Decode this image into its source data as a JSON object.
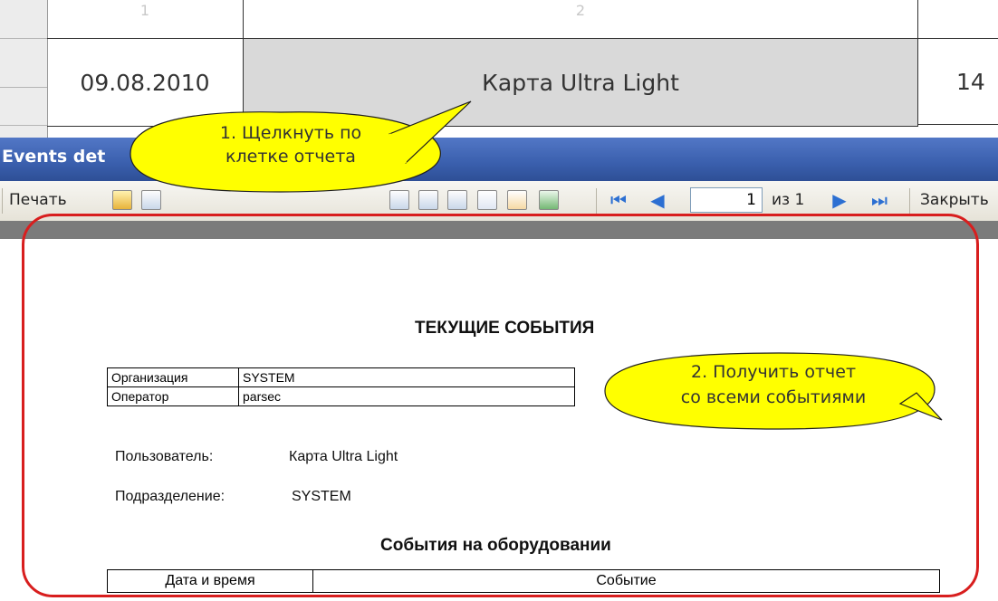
{
  "grid": {
    "header_cols": [
      "1",
      "2"
    ],
    "row": {
      "date": "09.08.2010",
      "card": "Карта Ultra Light",
      "number": "14"
    }
  },
  "window": {
    "title": "Events det"
  },
  "toolbar": {
    "print_label": "Печать",
    "page_value": "1",
    "page_of": "из 1",
    "close_label": "Закрыть"
  },
  "report": {
    "title": "ТЕКУЩИЕ СОБЫТИЯ",
    "info": [
      {
        "key": "Организация",
        "value": "SYSTEM"
      },
      {
        "key": "Оператор",
        "value": "parsec"
      }
    ],
    "user_label": "Пользователь:",
    "user_value": "Карта Ultra Light",
    "dept_label": "Подразделение:",
    "dept_value": "SYSTEM",
    "subtitle": "События на оборудовании",
    "columns": [
      "Дата и время",
      "Событие"
    ]
  },
  "callouts": {
    "step1_line1": "1. Щелкнуть по",
    "step1_line2": "клетке отчета",
    "step2_line1": "2. Получить отчет",
    "step2_line2": "со всеми событиями"
  },
  "colors": {
    "frame": "#d81e1e",
    "callout_fill": "#ffff00",
    "titlebar": "#3a5fad"
  }
}
